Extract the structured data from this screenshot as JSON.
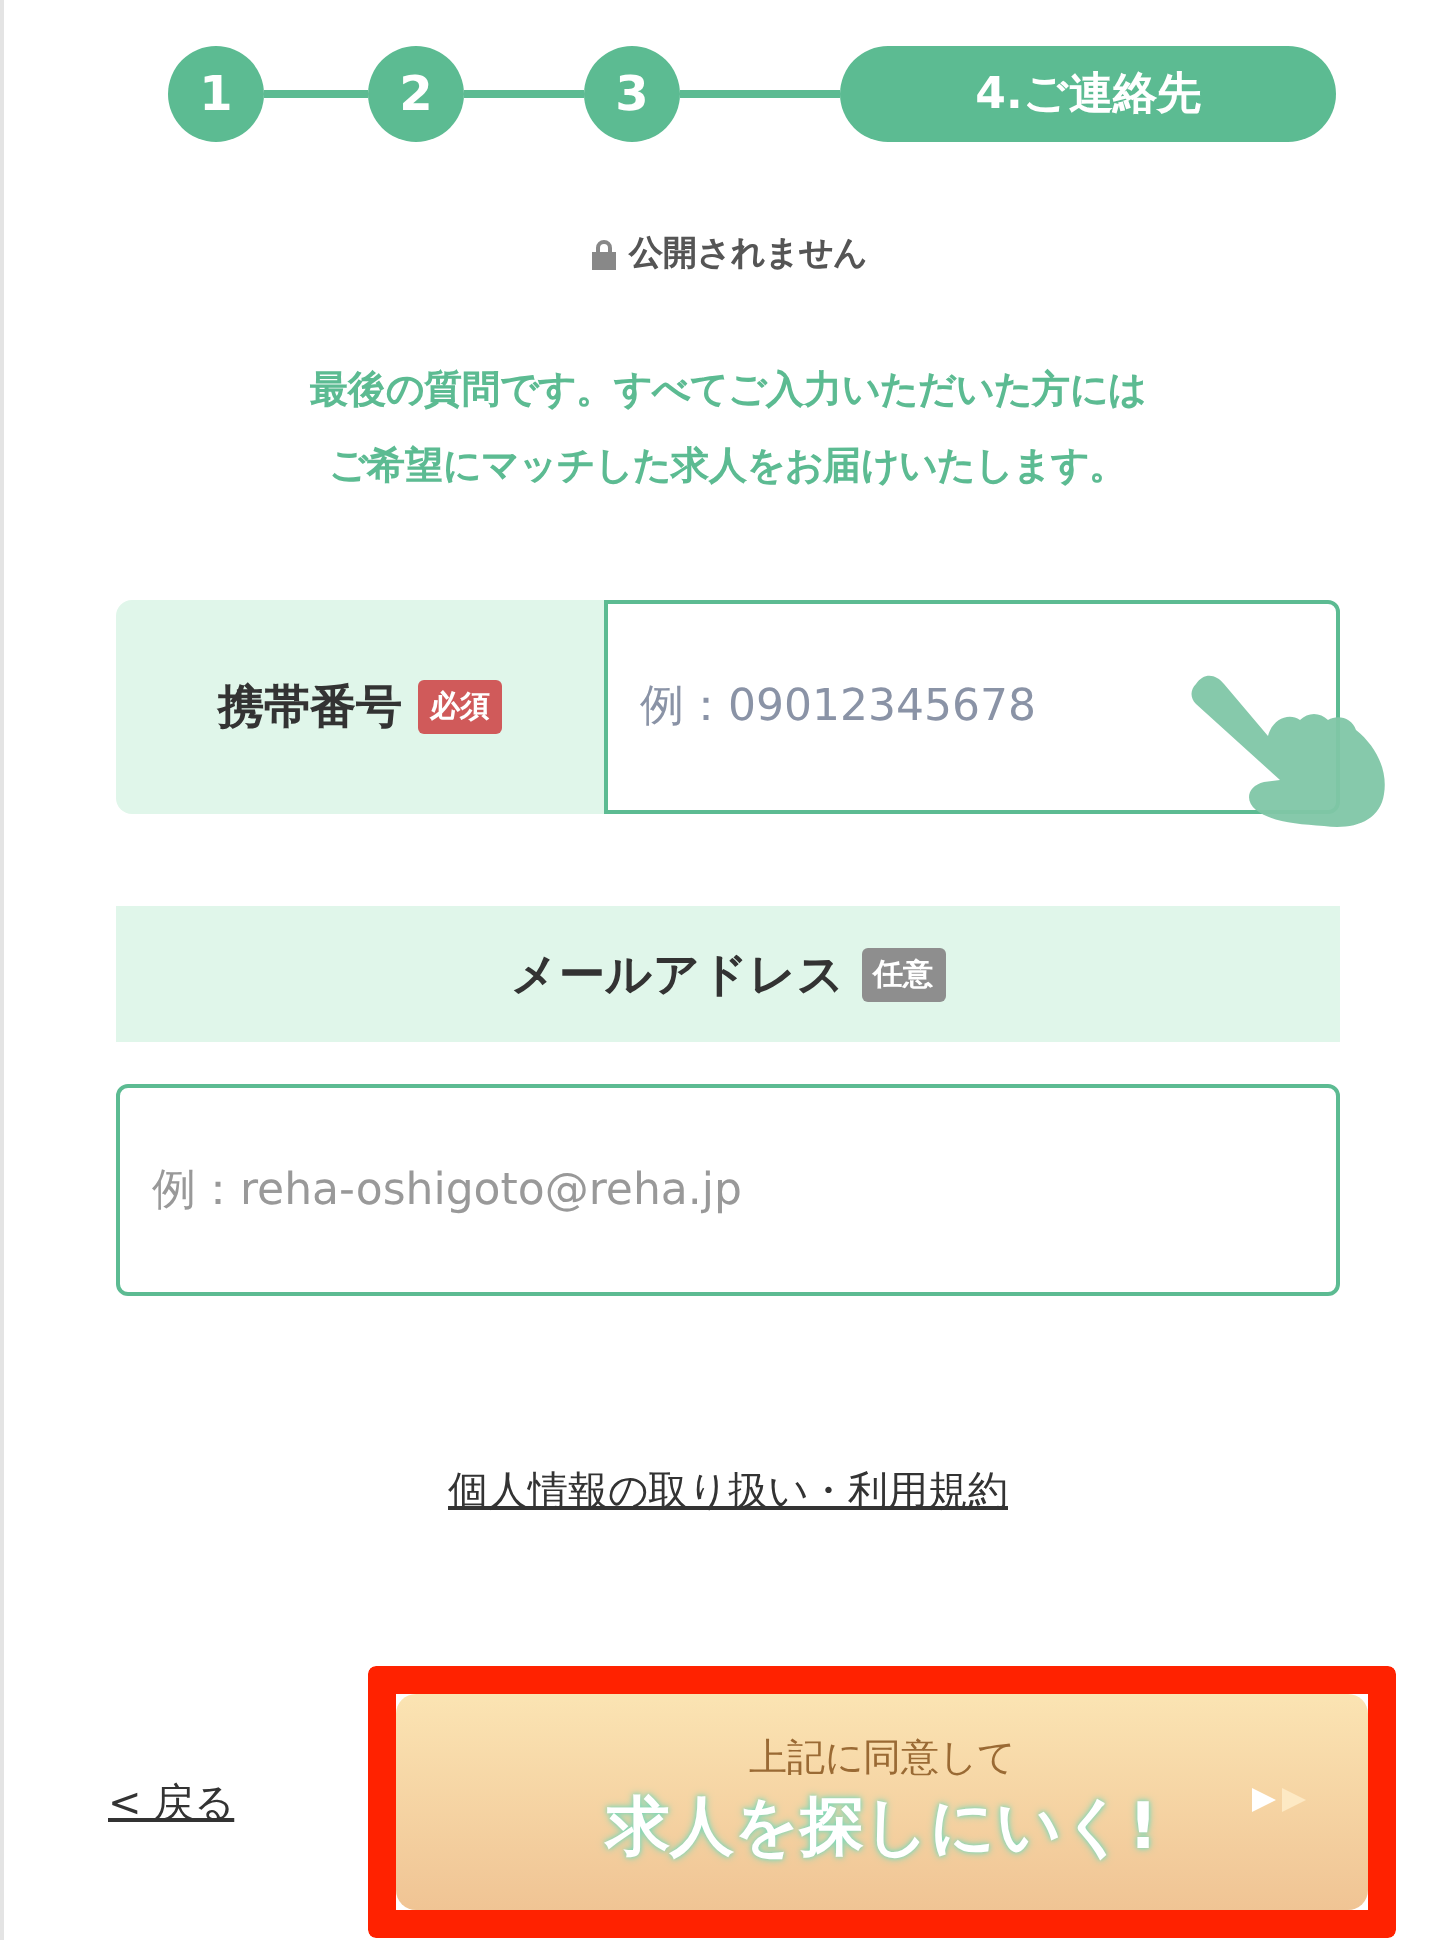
{
  "steps": [
    {
      "label": "1"
    },
    {
      "label": "2"
    },
    {
      "label": "3"
    },
    {
      "label": "4.ご連絡先"
    }
  ],
  "privacy_note": "公開されません",
  "intro": [
    "最後の質問です。すべてご入力いただいた方には",
    "ご希望にマッチした求人をお届けいたします。"
  ],
  "phone": {
    "label": "携帯番号",
    "badge": "必須",
    "required": true,
    "placeholder": "例：09012345678"
  },
  "email": {
    "label": "メールアドレス",
    "badge": "任意",
    "required": false,
    "placeholder": "例：reha-oshigoto@reha.jp"
  },
  "terms_link": "個人情報の取り扱い・利用規約",
  "back_link": "< 戻る",
  "submit": {
    "caption": "上記に同意して",
    "label": "求人を探しにいく!",
    "highlighted": true
  }
}
